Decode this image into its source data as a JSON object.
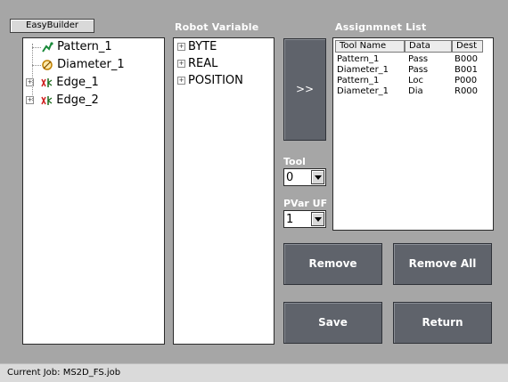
{
  "easybuilder_button": "EasyBuilder",
  "panels": {
    "robot_variable_header": "Robot Variable",
    "assignment_list_header": "Assignmnet List"
  },
  "tools_tree": [
    {
      "label": "Pattern_1",
      "icon": "pattern-icon"
    },
    {
      "label": "Diameter_1",
      "icon": "diameter-icon"
    },
    {
      "label": "Edge_1",
      "icon": "edge-icon"
    },
    {
      "label": "Edge_2",
      "icon": "edge-icon"
    }
  ],
  "robot_variables": [
    "BYTE",
    "REAL",
    "POSITION"
  ],
  "transfer_button": ">>",
  "tool_selector": {
    "label": "Tool",
    "value": "0"
  },
  "pvar_uf_selector": {
    "label": "PVar UF",
    "value": "1"
  },
  "assignment_table": {
    "columns": [
      "Tool Name",
      "Data",
      "Dest"
    ],
    "rows": [
      [
        "Pattern_1",
        "Pass",
        "B000"
      ],
      [
        "Diameter_1",
        "Pass",
        "B001"
      ],
      [
        "Pattern_1",
        "Loc",
        "P000"
      ],
      [
        "Diameter_1",
        "Dia",
        "R000"
      ]
    ]
  },
  "buttons": {
    "remove": "Remove",
    "remove_all": "Remove All",
    "save": "Save",
    "return": "Return"
  },
  "status": {
    "current_job": "Current Job: MS2D_FS.job"
  },
  "colors": {
    "background": "#a6a6a6",
    "button": "#5f636b",
    "status_bar": "#dadada"
  }
}
